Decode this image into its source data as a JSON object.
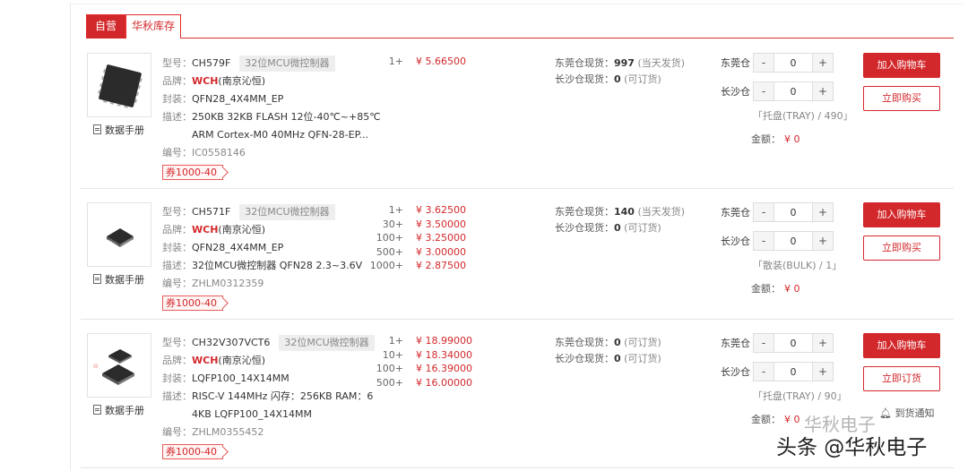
{
  "tabs": {
    "self": "自营",
    "huaqiu": "华秋库存"
  },
  "labels": {
    "model": "型号：",
    "brand": "品牌：",
    "package": "封装：",
    "desc": "描述：",
    "code": "编号：",
    "datasheet": "数据手册",
    "dongguan_stock": "东莞仓现货：",
    "changsha_stock": "长沙仓现货：",
    "dongguan_wh": "东莞仓",
    "changsha_wh": "长沙仓",
    "amount": "金额：",
    "add_cart": "加入购物车",
    "minus": "-",
    "plus": "+"
  },
  "products": [
    {
      "model": "CH579F",
      "category": "32位MCU微控制器",
      "brand": "WCH",
      "brand_cn": "(南京沁恒)",
      "package": "QFN28_4X4MM_EP",
      "desc1": "250KB 32KB FLASH 12位-40℃~+85℃",
      "desc2": "ARM Cortex-M0 40MHz QFN-28-EP...",
      "code": "IC0558146",
      "coupon": "券1000-40",
      "prices": [
        {
          "qty": "1+",
          "price": "¥ 5.66500"
        }
      ],
      "dongguan_count": "997",
      "dongguan_note": "(当天发货)",
      "changsha_count": "0",
      "changsha_note": "(可订货)",
      "dg_qty": "0",
      "cs_qty": "0",
      "pack": "「托盘(TRAY) / 490」",
      "amount": "¥ 0",
      "action2": "立即购买"
    },
    {
      "model": "CH571F",
      "category": "32位MCU微控制器",
      "brand": "WCH",
      "brand_cn": "(南京沁恒)",
      "package": "QFN28_4X4MM_EP",
      "desc1": "32位MCU微控制器 QFN28 2.3~3.6V",
      "code": "ZHLM0312359",
      "coupon": "券1000-40",
      "prices": [
        {
          "qty": "1+",
          "price": "¥ 3.62500"
        },
        {
          "qty": "30+",
          "price": "¥ 3.50000"
        },
        {
          "qty": "100+",
          "price": "¥ 3.25000"
        },
        {
          "qty": "500+",
          "price": "¥ 3.00000"
        },
        {
          "qty": "1000+",
          "price": "¥ 2.87500"
        }
      ],
      "dongguan_count": "140",
      "dongguan_note": "(当天发货)",
      "changsha_count": "0",
      "changsha_note": "(可订货)",
      "dg_qty": "0",
      "cs_qty": "0",
      "pack": "「散装(BULK) / 1」",
      "amount": "¥ 0",
      "action2": "立即购买"
    },
    {
      "model": "CH32V307VCT6",
      "category": "32位MCU微控制器",
      "brand": "WCH",
      "brand_cn": "(南京沁恒)",
      "package": "LQFP100_14X14MM",
      "desc1": "RISC-V 144MHz 闪存：256KB RAM：6",
      "desc2": "4KB LQFP100_14X14MM",
      "code": "ZHLM0355452",
      "coupon": "券1000-40",
      "prices": [
        {
          "qty": "1+",
          "price": "¥ 18.99000"
        },
        {
          "qty": "10+",
          "price": "¥ 18.34000"
        },
        {
          "qty": "100+",
          "price": "¥ 16.39000"
        },
        {
          "qty": "500+",
          "price": "¥ 16.00000"
        }
      ],
      "dongguan_count": "0",
      "dongguan_note": "(可订货)",
      "changsha_count": "0",
      "changsha_note": "(可订货)",
      "dg_qty": "0",
      "cs_qty": "0",
      "pack": "「托盘(TRAY) / 90」",
      "amount": "¥ 0",
      "action2": "立即订货",
      "notify": "到货通知"
    }
  ],
  "watermark": "头条 @华秋电子",
  "watermark_ghost": "华秋电子",
  "colors": {
    "accent": "#d3282b"
  }
}
